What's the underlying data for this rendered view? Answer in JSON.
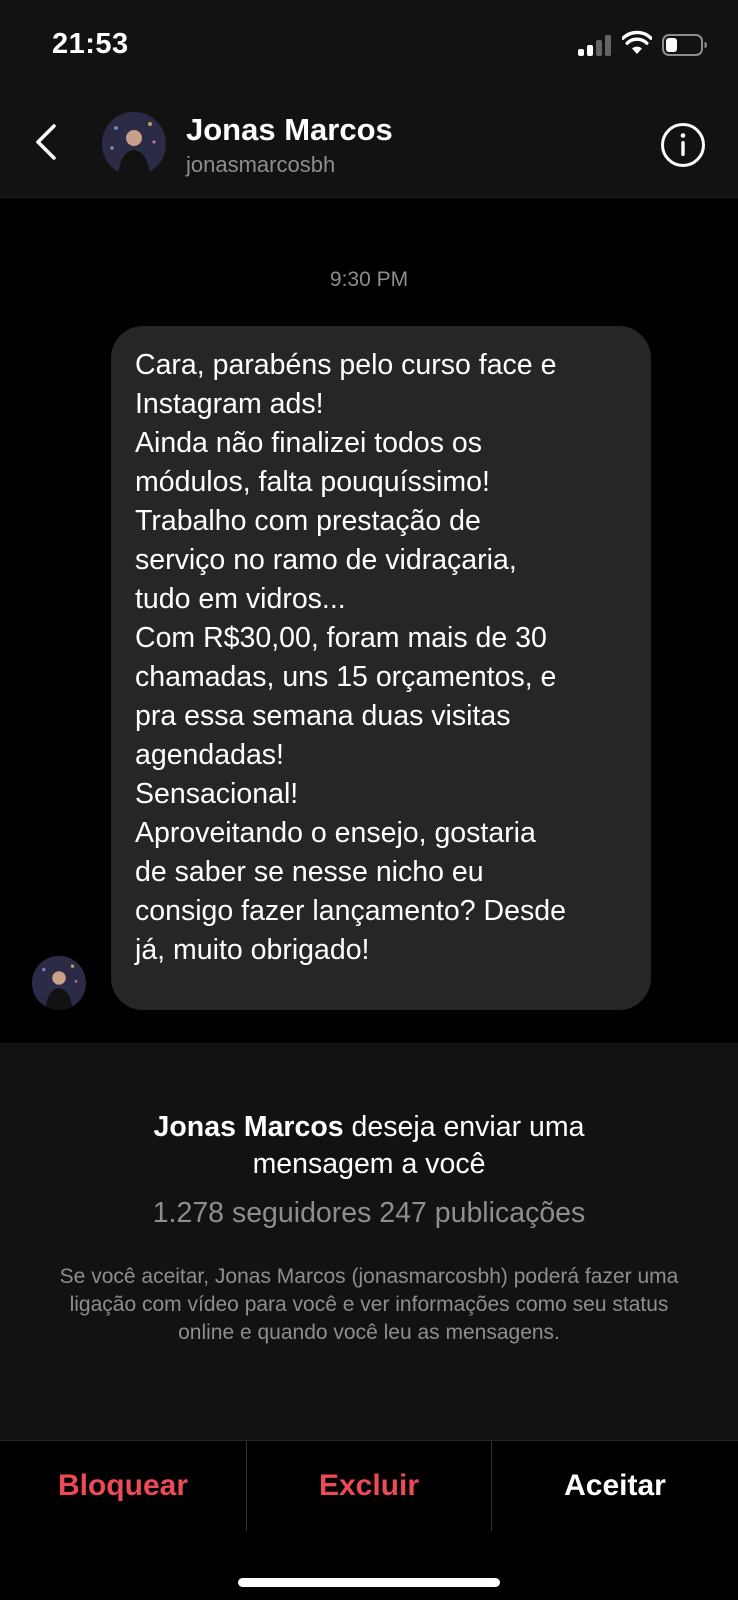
{
  "status_bar": {
    "time": "21:53"
  },
  "header": {
    "name": "Jonas Marcos",
    "username": "jonasmarcosbh"
  },
  "conversation": {
    "timestamp": "9:30 PM",
    "message_lines": [
      "Cara, parabéns pelo curso face e",
      "Instagram ads!",
      "Ainda não finalizei todos os",
      "módulos, falta pouquíssimo!",
      "Trabalho com prestação de",
      "serviço no ramo de vidraçaria,",
      "tudo em vidros...",
      "Com R$30,00, foram mais de 30",
      "chamadas, uns 15 orçamentos, e",
      "pra essa semana duas visitas",
      "agendadas!",
      "Sensacional!",
      "Aproveitando o ensejo, gostaria",
      "de saber se nesse nicho eu",
      "consigo fazer lançamento? Desde",
      "já, muito obrigado!"
    ]
  },
  "request": {
    "name": "Jonas Marcos",
    "title_line1_rest": " deseja enviar uma",
    "title_line2": "mensagem a você",
    "stats": "1.278 seguidores 247 publicações",
    "notice": "Se você aceitar, Jonas Marcos (jonasmarcosbh) poderá fazer uma ligação com vídeo para você e ver informações como seu status online e quando você leu as mensagens."
  },
  "actions": {
    "block": "Bloquear",
    "delete": "Excluir",
    "accept": "Aceitar"
  },
  "colors": {
    "destructive": "#ed4956",
    "bubble": "#262626",
    "secondary_text": "#8e8e8e"
  },
  "icons": [
    "back-chevron-icon",
    "info-icon",
    "signal-icon",
    "wifi-icon",
    "battery-icon"
  ]
}
